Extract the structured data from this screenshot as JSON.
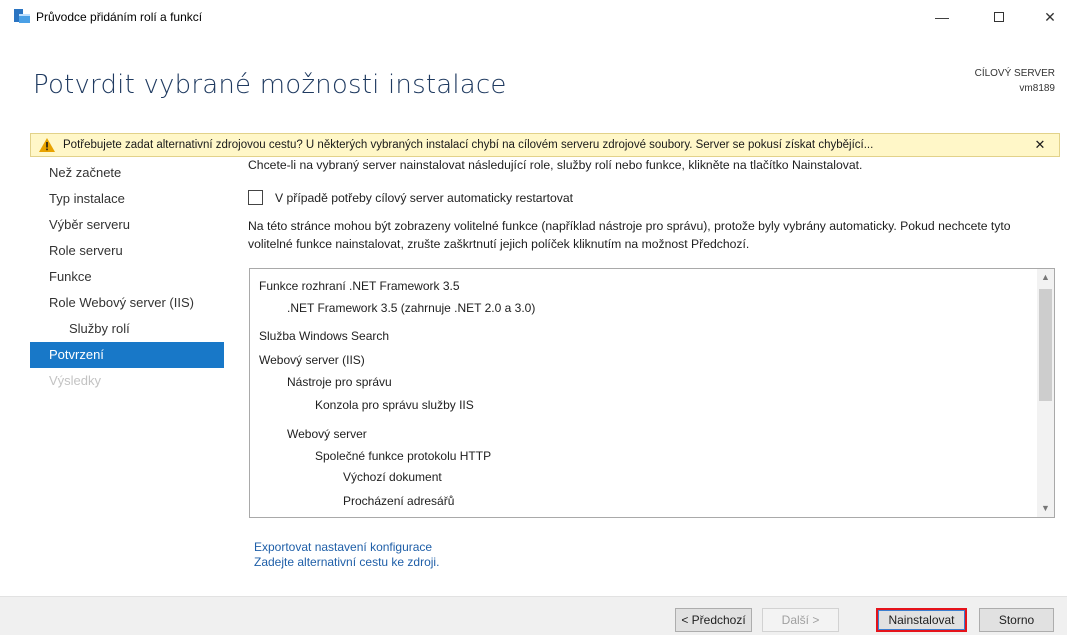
{
  "window": {
    "title": "Průvodce přidáním rolí a funkcí",
    "minimize": "—",
    "close": "✕"
  },
  "header": {
    "title": "Potvrdit vybrané možnosti instalace",
    "target_label": "CÍLOVÝ SERVER",
    "target_name": "vm8189"
  },
  "warning": {
    "text": "Potřebujete zadat alternativní zdrojovou cestu? U některých vybraných instalací chybí na cílovém serveru zdrojové soubory. Server se pokusí získat chybějící...",
    "close": "✕"
  },
  "nav": {
    "items": [
      {
        "label": "Než začnete"
      },
      {
        "label": "Typ instalace"
      },
      {
        "label": "Výběr serveru"
      },
      {
        "label": "Role serveru"
      },
      {
        "label": "Funkce"
      },
      {
        "label": "Role Webový server (IIS)"
      },
      {
        "label": "Služby rolí"
      },
      {
        "label": "Potvrzení"
      },
      {
        "label": "Výsledky"
      }
    ]
  },
  "main": {
    "intro": "Chcete-li na vybraný server nainstalovat následující role, služby rolí nebo funkce, klikněte na tlačítko Nainstalovat.",
    "restart_label": "V případě potřeby cílový server automaticky restartovat",
    "note": "Na této stránce mohou být zobrazeny volitelné funkce (například nástroje pro správu), protože byly vybrány automaticky. Pokud nechcete tyto volitelné funkce nainstalovat, zrušte zaškrtnutí jejich políček kliknutím na možnost Předchozí.",
    "features": [
      "Funkce rozhraní .NET Framework 3.5",
      ".NET Framework 3.5 (zahrnuje .NET 2.0 a 3.0)",
      "Služba Windows Search",
      "Webový server (IIS)",
      "Nástroje pro správu",
      "Konzola pro správu služby IIS",
      "Webový server",
      "Společné funkce protokolu HTTP",
      "Výchozí dokument",
      "Procházení adresářů"
    ],
    "export_link": "Exportovat nastavení konfigurace",
    "source_link": "Zadejte alternativní cestu ke zdroji."
  },
  "footer": {
    "previous": "< Předchozí",
    "next": "Další >",
    "install": "Nainstalovat",
    "cancel": "Storno"
  },
  "colors": {
    "accent": "#1878c8",
    "title": "#1f3a60",
    "warning_bg": "#fff7c8",
    "link": "#1f5fa8",
    "highlight": "#e5131b"
  }
}
